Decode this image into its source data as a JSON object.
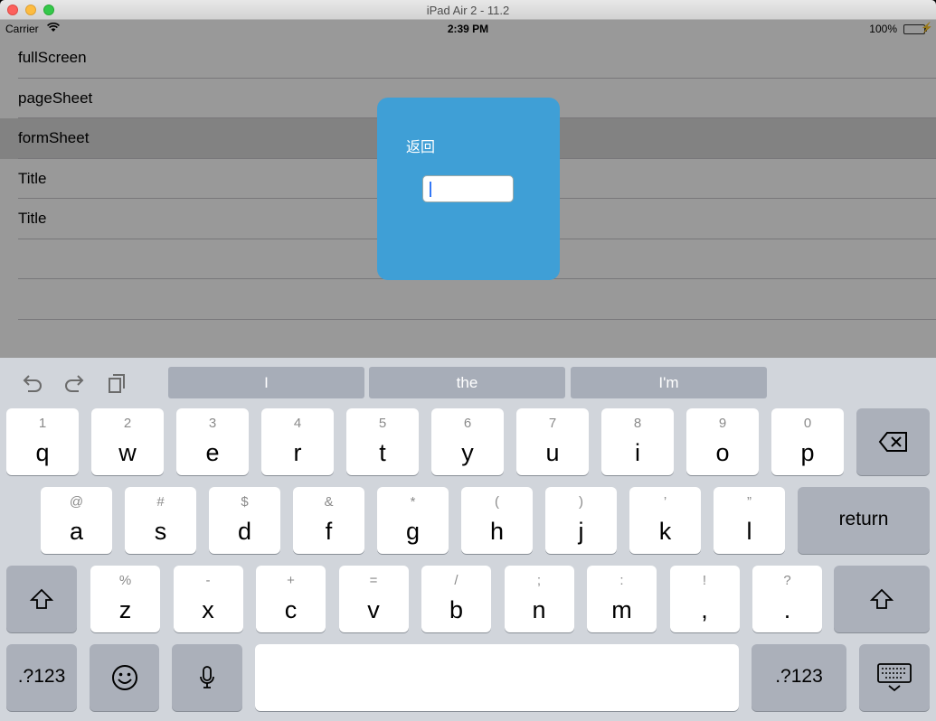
{
  "window": {
    "title": "iPad Air 2 - 11.2"
  },
  "status_bar": {
    "carrier": "Carrier",
    "time": "2:39 PM",
    "battery": "100%"
  },
  "table": {
    "rows": [
      {
        "label": "fullScreen"
      },
      {
        "label": "pageSheet"
      },
      {
        "label": "formSheet",
        "selected": true
      },
      {
        "label": "Title"
      },
      {
        "label": "Title"
      },
      {
        "label": ""
      },
      {
        "label": ""
      },
      {
        "label": ""
      }
    ]
  },
  "modal": {
    "back_label": "返回",
    "text_field_value": ""
  },
  "keyboard": {
    "predictions": [
      "I",
      "the",
      "I'm"
    ],
    "row1": [
      {
        "hint": "1",
        "key": "q"
      },
      {
        "hint": "2",
        "key": "w"
      },
      {
        "hint": "3",
        "key": "e"
      },
      {
        "hint": "4",
        "key": "r"
      },
      {
        "hint": "5",
        "key": "t"
      },
      {
        "hint": "6",
        "key": "y"
      },
      {
        "hint": "7",
        "key": "u"
      },
      {
        "hint": "8",
        "key": "i"
      },
      {
        "hint": "9",
        "key": "o"
      },
      {
        "hint": "0",
        "key": "p"
      }
    ],
    "row2": [
      {
        "hint": "@",
        "key": "a"
      },
      {
        "hint": "#",
        "key": "s"
      },
      {
        "hint": "$",
        "key": "d"
      },
      {
        "hint": "&",
        "key": "f"
      },
      {
        "hint": "*",
        "key": "g"
      },
      {
        "hint": "(",
        "key": "h"
      },
      {
        "hint": ")",
        "key": "j"
      },
      {
        "hint": "’",
        "key": "k"
      },
      {
        "hint": "”",
        "key": "l"
      }
    ],
    "row3": [
      {
        "hint": "%",
        "key": "z"
      },
      {
        "hint": "-",
        "key": "x"
      },
      {
        "hint": "+",
        "key": "c"
      },
      {
        "hint": "=",
        "key": "v"
      },
      {
        "hint": "/",
        "key": "b"
      },
      {
        "hint": ";",
        "key": "n"
      },
      {
        "hint": ":",
        "key": "m"
      },
      {
        "hint": "!",
        "key": ","
      },
      {
        "hint": "?",
        "key": "."
      }
    ],
    "return_label": "return",
    "numbers_label": ".?123"
  },
  "colors": {
    "modal_background": "#3f9fd6",
    "keyboard_background": "#d1d5db"
  }
}
